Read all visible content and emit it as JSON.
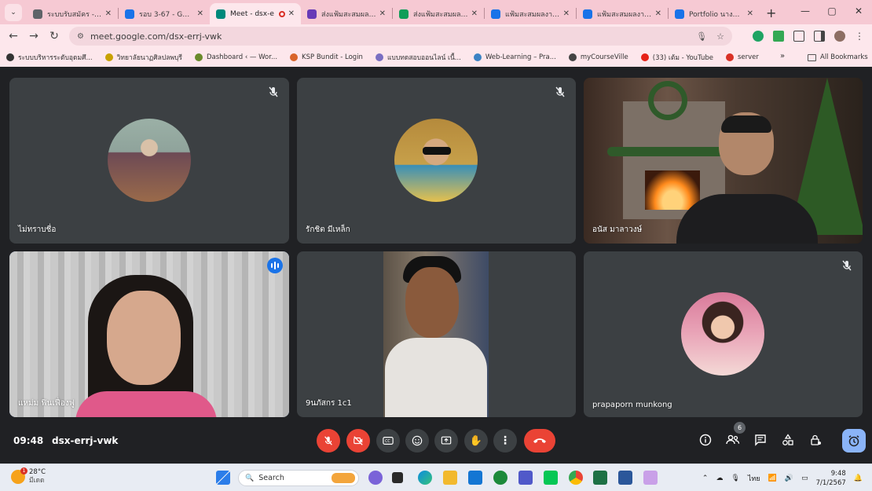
{
  "browser": {
    "tabs": [
      {
        "title": "ระบบรับสมัคร - ระบ",
        "color": "#5f6368",
        "active": false
      },
      {
        "title": "รอบ 3-67 - Goog",
        "color": "#1a73e8",
        "active": false
      },
      {
        "title": "Meet - dsx-e",
        "color": "#00897b",
        "active": true,
        "recording": true
      },
      {
        "title": "ส่งแฟ้มสะสมผลงาน",
        "color": "#673ab7",
        "active": false
      },
      {
        "title": "ส่งแฟ้มสะสมผลงาน",
        "color": "#0f9d58",
        "active": false
      },
      {
        "title": "แฟ้มสะสมผลงาน ร",
        "color": "#1a73e8",
        "active": false
      },
      {
        "title": "แฟ้มสะสมผลงาน ร",
        "color": "#1a73e8",
        "active": false
      },
      {
        "title": "Portfolio นางสาวโ",
        "color": "#1a73e8",
        "active": false
      }
    ],
    "url": "meet.google.com/dsx-errj-vwk",
    "bookmarks": [
      {
        "label": "ระบบบริหารระดับอุดมศึ...",
        "color": "#333"
      },
      {
        "label": "วิทยาลัยนาฏศิลปลพบุรี",
        "color": "#c8a100"
      },
      {
        "label": "Dashboard ‹ — Wor...",
        "color": "#6a8a2b"
      },
      {
        "label": "KSP Bundit - Login",
        "color": "#d9642a"
      },
      {
        "label": "แบบทดสอบออนไลน์ เนื้...",
        "color": "#7a6fc2"
      },
      {
        "label": "Web-Learning – Pra...",
        "color": "#3b82c4"
      },
      {
        "label": "myCourseVille",
        "color": "#444"
      },
      {
        "label": "(33) เต้ม - YouTube",
        "color": "#e62117"
      },
      {
        "label": "server",
        "color": "#d93025"
      }
    ],
    "all_bookmarks": "All Bookmarks"
  },
  "meet": {
    "participants": [
      {
        "name": "ไม่ทราบชื่อ",
        "muted": true,
        "type": "avatar",
        "avatar_colors": [
          "#8fa39b",
          "#6d4a55"
        ]
      },
      {
        "name": "รักชิต มีเหล็ก",
        "muted": true,
        "type": "avatar",
        "avatar_colors": [
          "#c7a04a",
          "#3a8fb7"
        ]
      },
      {
        "name": "อนัส มาลาวงษ์",
        "muted": false,
        "type": "video-christmas"
      },
      {
        "name": "แหม่ม ฟินเฟื่องฟู",
        "muted": false,
        "type": "video-speaker",
        "speaking": true
      },
      {
        "name": "9นภัสกร 1c1",
        "muted": false,
        "type": "video-student"
      },
      {
        "name": "prapaporn munkong",
        "muted": true,
        "type": "avatar",
        "avatar_colors": [
          "#e9a5b8",
          "#6a3a3a"
        ]
      }
    ],
    "time": "09:48",
    "code": "dsx-errj-vwk",
    "people_count": "6",
    "controls": [
      "mic-off-icon",
      "camera-off-icon",
      "captions-icon",
      "emoji-icon",
      "present-icon",
      "raise-hand-icon",
      "more-options-icon",
      "end-call-icon"
    ]
  },
  "taskbar": {
    "temperature": "28°C",
    "weather_desc": "มีเดด",
    "weather_badge": "1",
    "search_placeholder": "Search",
    "language": "ไทย",
    "clock_time": "9:48",
    "clock_date": "7/1/2567"
  }
}
